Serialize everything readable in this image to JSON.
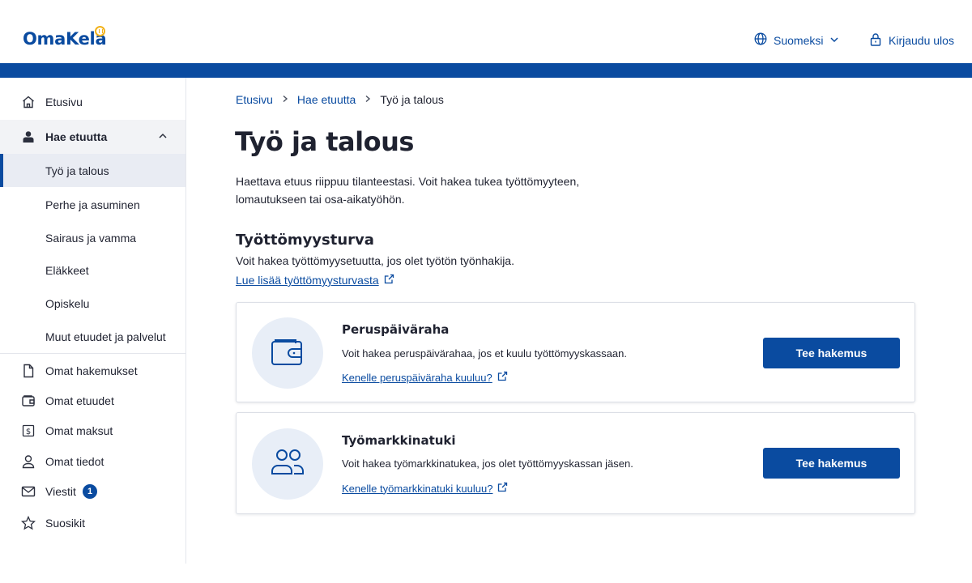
{
  "header": {
    "logo_text": "OmaKela",
    "language_label": "Suomeksi",
    "logout_label": "Kirjaudu ulos"
  },
  "sidebar": {
    "items": [
      {
        "label": "Etusivu",
        "icon": "home-icon"
      },
      {
        "label": "Hae etuutta",
        "icon": "person-stamp-icon",
        "expanded": true
      },
      {
        "label": "Työ ja talous",
        "active": true
      },
      {
        "label": "Perhe ja asuminen"
      },
      {
        "label": "Sairaus ja vamma"
      },
      {
        "label": "Eläkkeet"
      },
      {
        "label": "Opiskelu"
      },
      {
        "label": "Muut etuudet ja palvelut"
      },
      {
        "label": "Omat hakemukset",
        "icon": "document-icon"
      },
      {
        "label": "Omat etuudet",
        "icon": "wallet-icon"
      },
      {
        "label": "Omat maksut",
        "icon": "dollar-icon"
      },
      {
        "label": "Omat tiedot",
        "icon": "person-icon"
      },
      {
        "label": "Viestit",
        "icon": "mail-icon",
        "badge": "1"
      },
      {
        "label": "Suosikit",
        "icon": "star-icon"
      }
    ]
  },
  "breadcrumb": {
    "items": [
      "Etusivu",
      "Hae etuutta",
      "Työ ja talous"
    ]
  },
  "main": {
    "title": "Työ ja talous",
    "intro_line1": "Haettava etuus riippuu tilanteestasi. Voit hakea tukea työttömyyteen,",
    "intro_line2": "lomautukseen tai osa-aikatyöhön.",
    "section": {
      "title": "Työttömyysturva",
      "description": "Voit hakea työttömyysetuutta, jos olet työtön työnhakija.",
      "link": "Lue lisää työttömyysturvasta"
    },
    "cards": [
      {
        "title": "Peruspäiväraha",
        "description": "Voit hakea peruspäivärahaa, jos et kuulu työttömyyskassaan.",
        "link": "Kenelle peruspäiväraha kuuluu?",
        "button": "Tee hakemus",
        "icon": "wallet-icon"
      },
      {
        "title": "Työmarkkinatuki",
        "description": "Voit hakea työmarkkinatukea, jos olet työttömyyskassan jäsen.",
        "link": "Kenelle työmarkkinatuki kuuluu?",
        "button": "Tee hakemus",
        "icon": "people-icon"
      }
    ]
  },
  "colors": {
    "brand_blue": "#0a4ba0",
    "accent_yellow": "#f2b21b",
    "icon_circle": "#e8eef7",
    "active_bg": "#e9ecf3"
  }
}
